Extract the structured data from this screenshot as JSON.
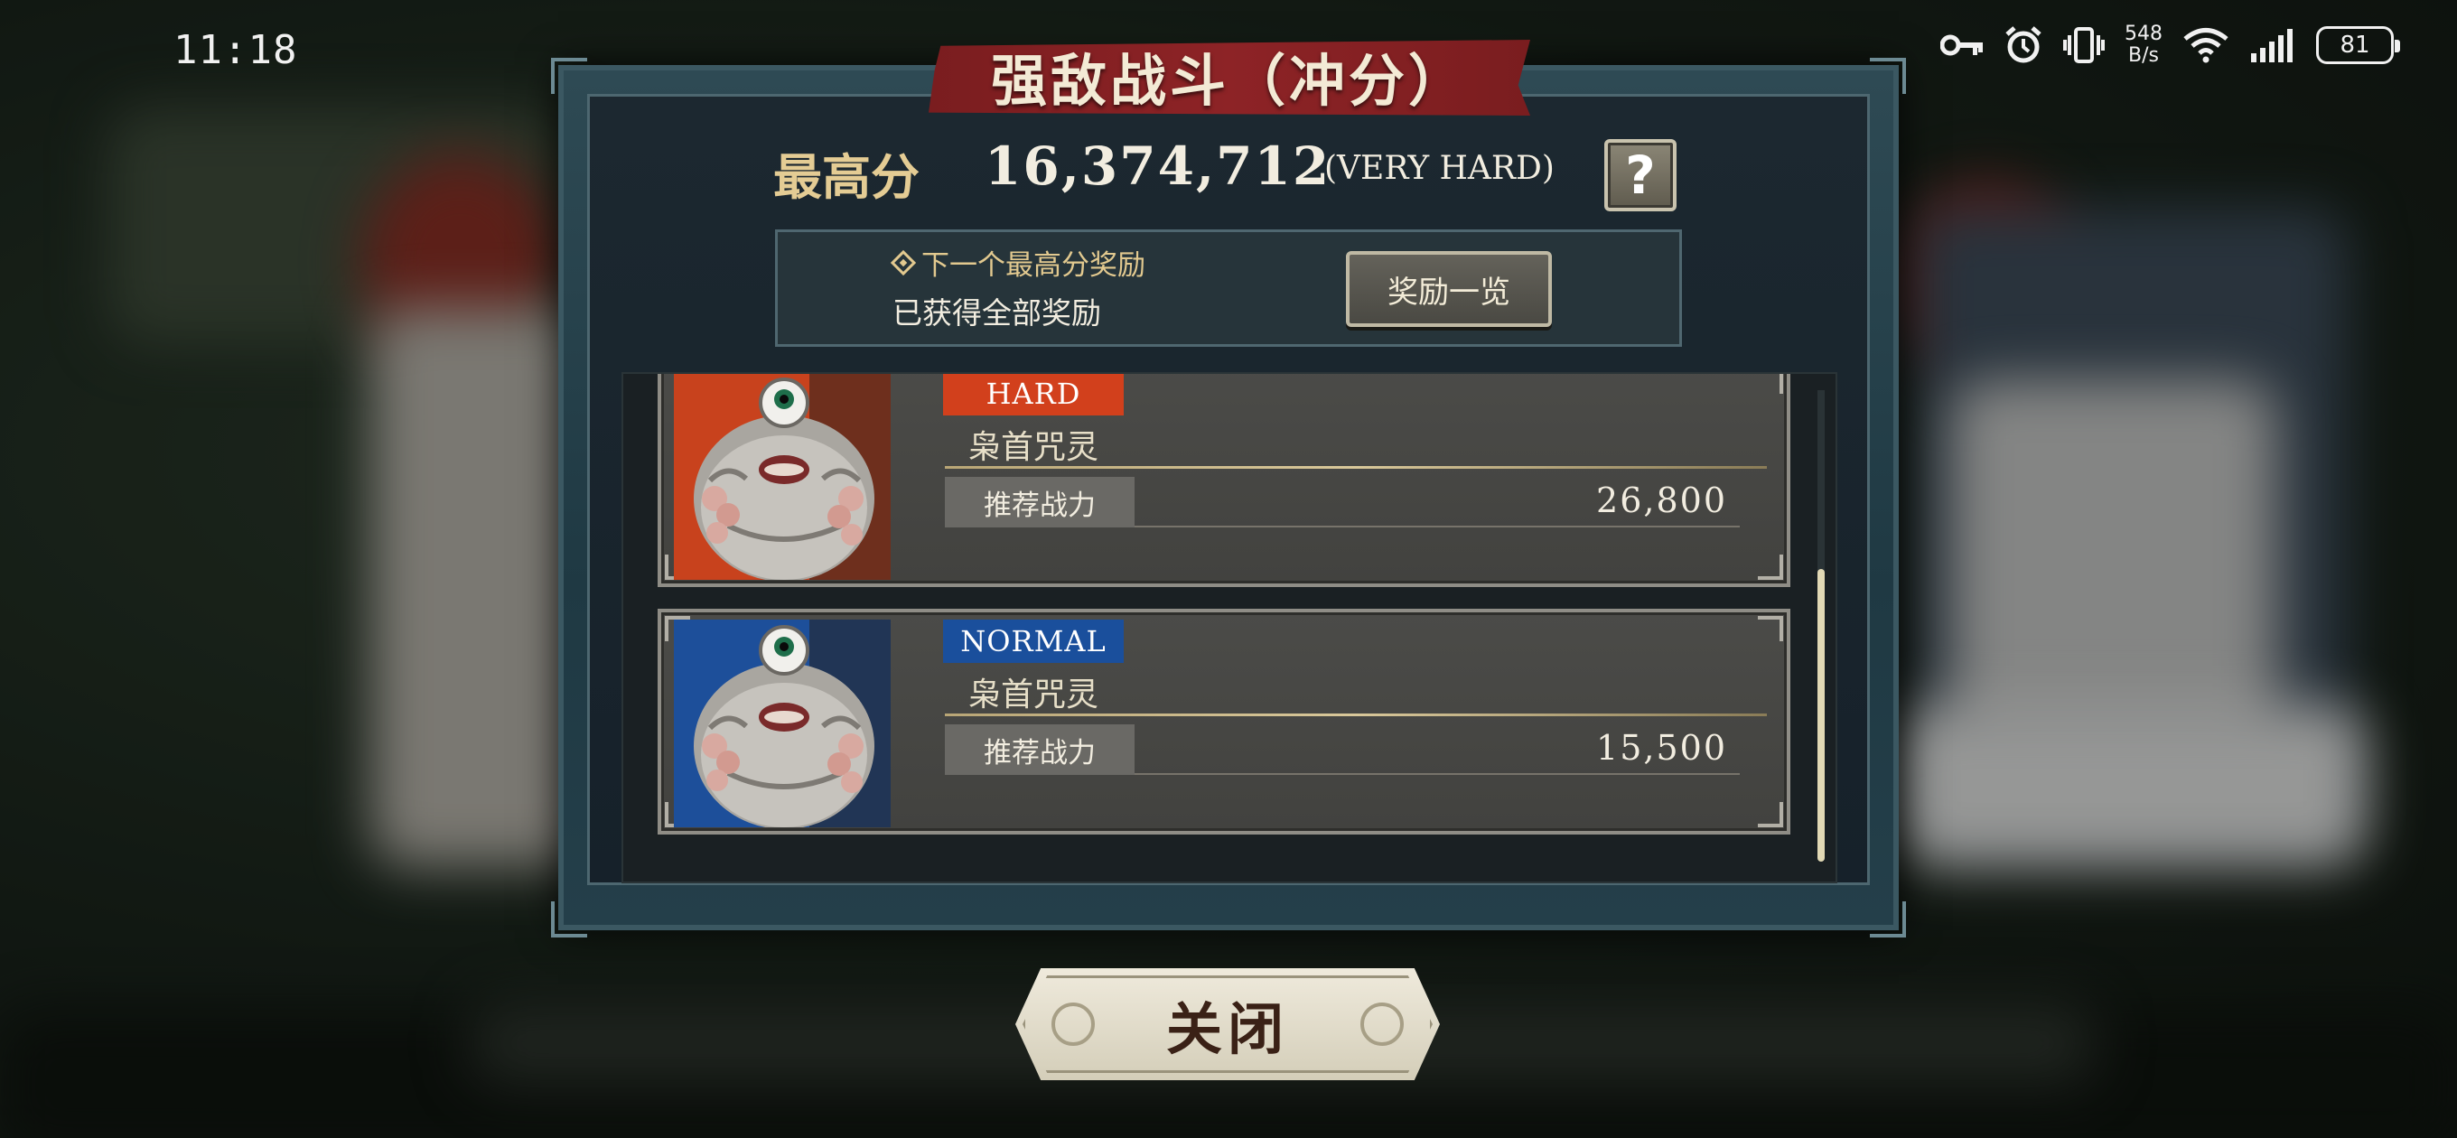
{
  "status_bar": {
    "time": "11:18",
    "net_speed_value": "548",
    "net_speed_unit": "B/s",
    "battery": "81",
    "icons": [
      "key-icon",
      "alarm-icon",
      "vibrate-icon",
      "wifi-icon",
      "signal-icon",
      "battery-icon"
    ]
  },
  "dialog": {
    "title": "强敌战斗（冲分）",
    "score_label": "最高分",
    "score_value": "16,374,712",
    "score_difficulty": "(VERY HARD)",
    "help_label": "?",
    "reward": {
      "next_label": "下一个最高分奖励",
      "status": "已获得全部奖励",
      "list_button": "奖励一览"
    },
    "enemies": [
      {
        "difficulty": "HARD",
        "difficulty_color": "#d2401c",
        "bg_color": "#c8421d",
        "name": "枭首咒灵",
        "power_label": "推荐战力",
        "power_value": "26,800"
      },
      {
        "difficulty": "NORMAL",
        "difficulty_color": "#1a4f9c",
        "bg_color": "#1d4f9a",
        "name": "枭首咒灵",
        "power_label": "推荐战力",
        "power_value": "15,500"
      }
    ]
  },
  "close_button": "关闭",
  "colors": {
    "panel": "#1c2830",
    "frame": "#2e4a54",
    "title_banner": "#8d2326",
    "gold_text": "#e4cc94"
  }
}
